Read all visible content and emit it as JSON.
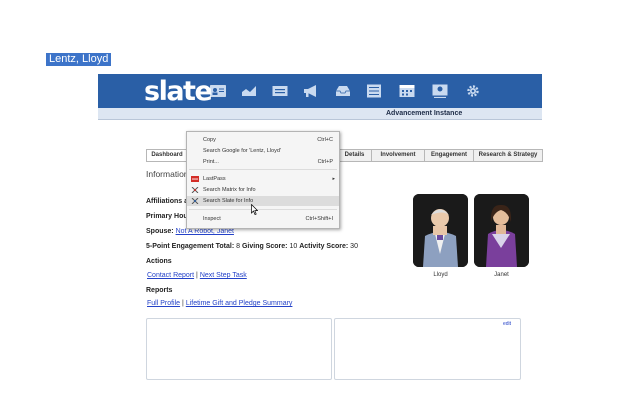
{
  "app": {
    "logo": "slate",
    "subheader": "Advancement Instance",
    "nav_icons": [
      "contact-card-icon",
      "chart-icon",
      "id-card-icon",
      "megaphone-icon",
      "inbox-icon",
      "list-icon",
      "calendar-icon",
      "map-pin-icon",
      "gear-icon"
    ]
  },
  "person": {
    "name": "Lentz, Lloyd"
  },
  "tabs": [
    {
      "label": "Dashboard"
    },
    {
      "label": "Details"
    },
    {
      "label": "Involvement"
    },
    {
      "label": "Engagement"
    },
    {
      "label": "Research & Strategy"
    }
  ],
  "content": {
    "section_title": "Information",
    "affiliations_label": "Affiliations a",
    "primary_label": "Primary Hou",
    "spouse_label": "Spouse:",
    "spouse_value": "Not A Robot, Janet",
    "engagement_label": "5-Point Engagement Total:",
    "engagement_value": "8",
    "giving_label": "Giving Score:",
    "giving_value": "10",
    "activity_label": "Activity Score:",
    "activity_value": "30",
    "actions_title": "Actions",
    "action_links": [
      "Contact Report",
      "Next Step Task"
    ],
    "reports_title": "Reports",
    "report_links": [
      "Full Profile",
      "Lifetime Gift and Pledge Summary"
    ],
    "link_separator": "|",
    "card_mark": "edit"
  },
  "photos": [
    {
      "caption": "Lloyd"
    },
    {
      "caption": "Janet"
    }
  ],
  "context_menu": {
    "items": [
      {
        "label": "Copy",
        "shortcut": "Ctrl+C"
      },
      {
        "label": "Search Google for 'Lentz, Lloyd'"
      },
      {
        "label": "Print...",
        "shortcut": "Ctrl+P"
      },
      {
        "label": "LastPass",
        "submenu": "▸"
      },
      {
        "label": "Search Matrix for Info"
      },
      {
        "label": "Search Slate for Info"
      },
      {
        "label": "Inspect",
        "shortcut": "Ctrl+Shift+I"
      }
    ]
  },
  "colors": {
    "banner": "#2a5fa6",
    "selection": "#3d74c9",
    "link": "#2442c8",
    "lastpass": "#d32d27"
  }
}
